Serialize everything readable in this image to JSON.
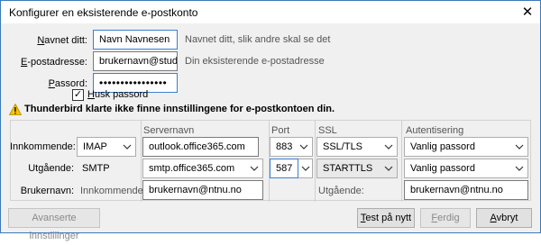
{
  "window": {
    "title": "Konfigurer en eksisterende e-postkonto"
  },
  "form": {
    "name_label_u": "N",
    "name_label_rest": "avnet ditt:",
    "name_value": "Navn Navnesen",
    "name_hint": "Navnet ditt, slik andre skal se det",
    "email_label_u": "E",
    "email_label_rest": "-postadresse:",
    "email_value": "brukernavn@stud.ntnu.no",
    "email_hint": "Din eksisterende e-postadresse",
    "password_label_u": "P",
    "password_label_rest": "assord:",
    "password_value": "••••••••••••••••",
    "remember_u": "H",
    "remember_rest": "usk passord",
    "remember_checked": true
  },
  "warning": {
    "text": "Thunderbird klarte ikke finne innstillingene for e-postkontoen din."
  },
  "server": {
    "headers": {
      "server": "Servernavn",
      "port": "Port",
      "ssl": "SSL",
      "auth": "Autentisering"
    },
    "incoming": {
      "label": "Innkommende:",
      "protocol": "IMAP",
      "server": "outlook.office365.com",
      "port": "883",
      "ssl": "SSL/TLS",
      "auth": "Vanlig passord"
    },
    "outgoing": {
      "label": "Utgående:",
      "protocol": "SMTP",
      "server": "smtp.office365.com",
      "port": "587",
      "ssl": "STARTTLS",
      "auth": "Vanlig passord"
    },
    "username": {
      "label": "Brukernavn:",
      "incoming_label": "Innkommende:",
      "incoming_value": "brukernavn@ntnu.no",
      "outgoing_label": "Utgående:",
      "outgoing_value": "brukernavn@ntnu.no"
    }
  },
  "buttons": {
    "advanced": "Avanserte innstillinger",
    "retest_u": "T",
    "retest_rest": "est på nytt",
    "done_u": "F",
    "done_rest": "erdig",
    "cancel_u": "A",
    "cancel_rest": "vbryt"
  },
  "colors": {
    "focus": "#3c7fd0",
    "warning": "#f5c400",
    "border": "#3c7ab8"
  }
}
